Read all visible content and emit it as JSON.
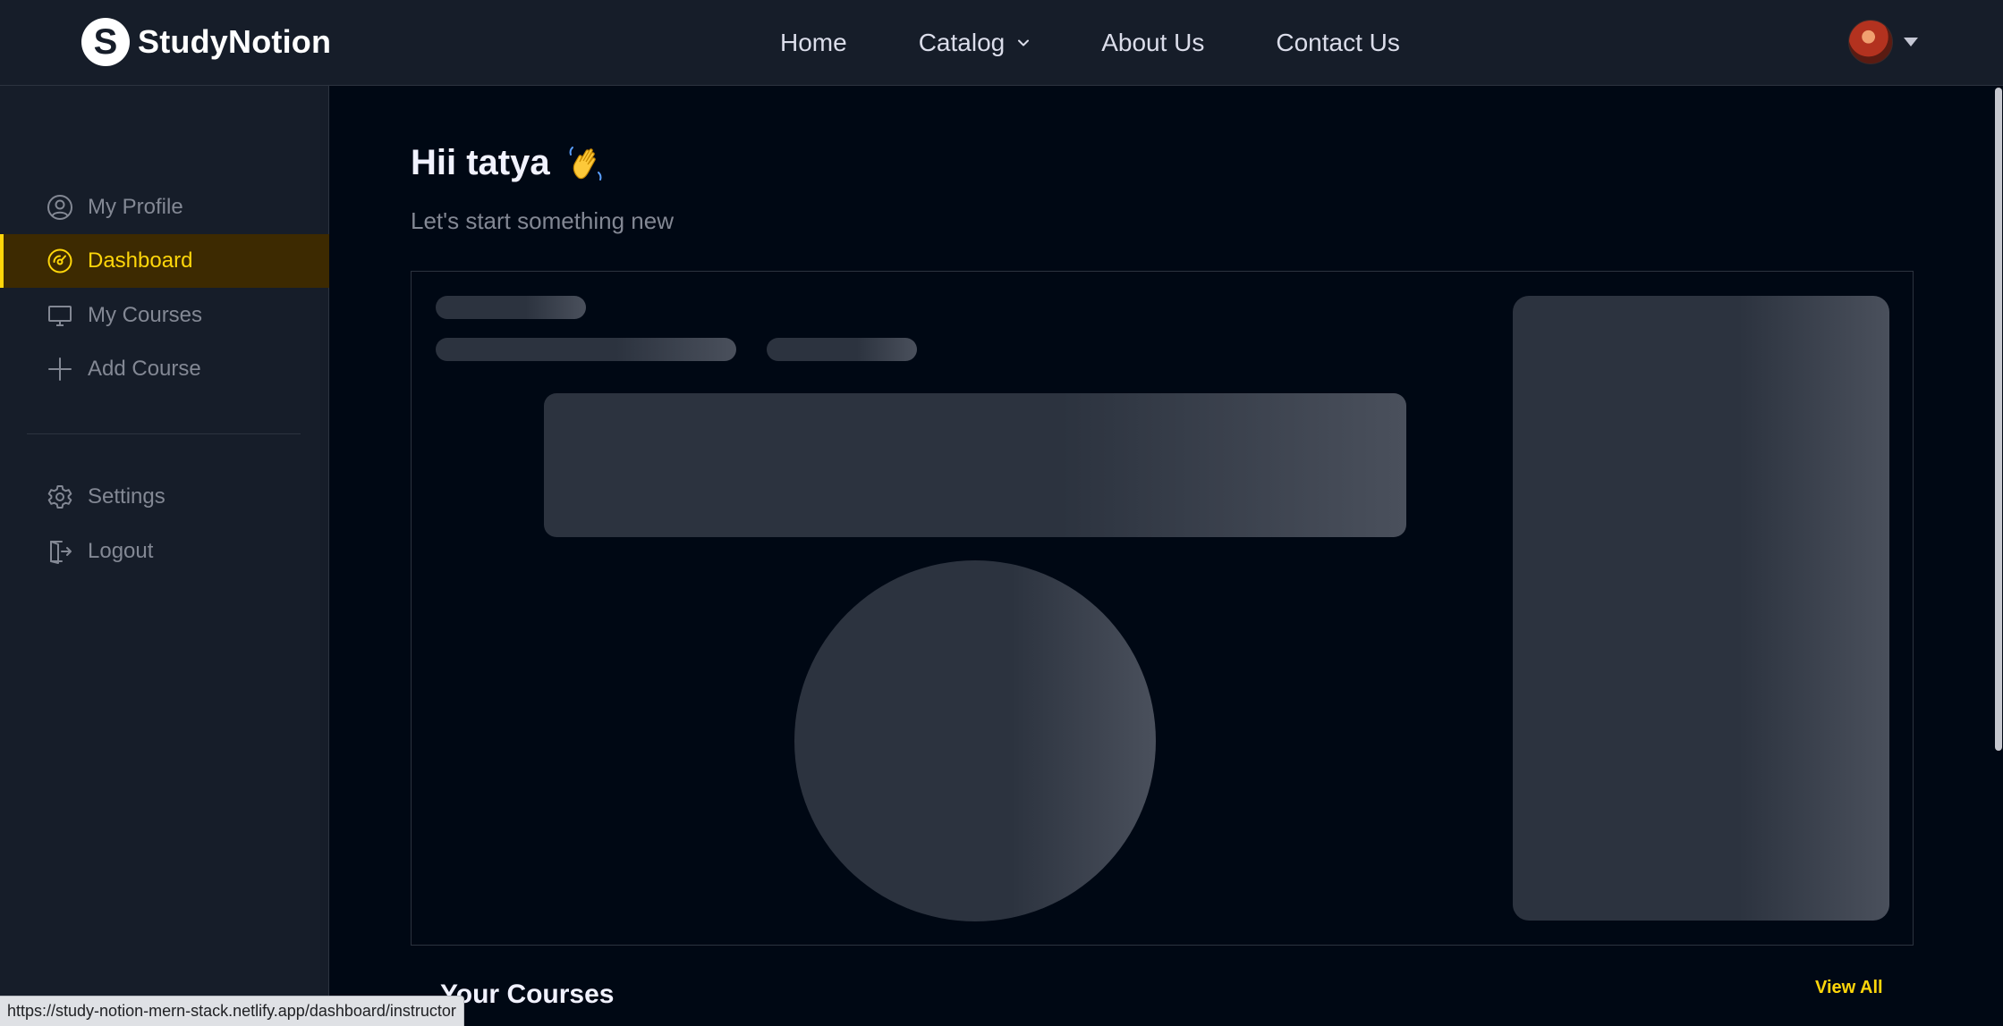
{
  "brand": {
    "name": "StudyNotion",
    "logo_letter": "S"
  },
  "nav": {
    "links": [
      {
        "label": "Home"
      },
      {
        "label": "Catalog",
        "has_dropdown": true
      },
      {
        "label": "About Us"
      },
      {
        "label": "Contact Us"
      }
    ]
  },
  "sidebar": {
    "items": [
      {
        "label": "My Profile",
        "icon": "user-circle-icon",
        "active": false
      },
      {
        "label": "Dashboard",
        "icon": "gauge-icon",
        "active": true
      },
      {
        "label": "My Courses",
        "icon": "monitor-icon",
        "active": false
      },
      {
        "label": "Add Course",
        "icon": "plus-icon",
        "active": false
      }
    ],
    "bottom_items": [
      {
        "label": "Settings",
        "icon": "gear-icon"
      },
      {
        "label": "Logout",
        "icon": "logout-icon"
      }
    ]
  },
  "main": {
    "greeting": "Hii tatya",
    "greeting_emoji": "waving-hand-icon",
    "subtitle": "Let's start something new",
    "courses_title": "Your Courses",
    "view_all_label": "View All"
  },
  "status_bar": {
    "url": "https://study-notion-mern-stack.netlify.app/dashboard/instructor"
  },
  "colors": {
    "background": "#000814",
    "panel": "#161d29",
    "accent": "#ffd60a",
    "active_bg": "#3d2a01",
    "muted_text": "#838894",
    "skeleton": "#2c333f"
  }
}
